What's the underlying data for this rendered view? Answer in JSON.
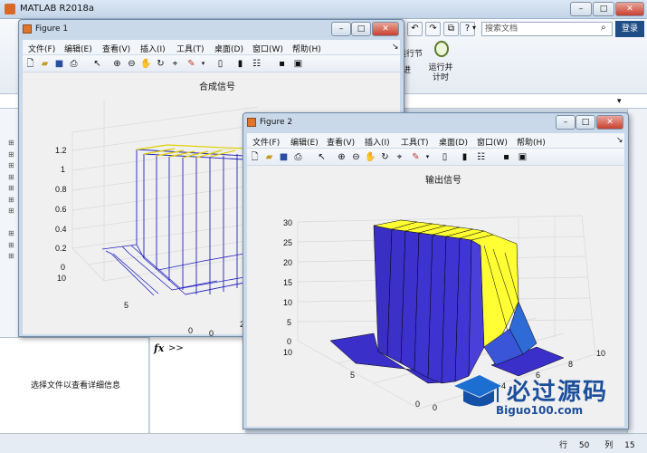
{
  "main_window": {
    "title": "MATLAB R2018a",
    "search_placeholder": "搜索文档",
    "login_label": "登录",
    "run_section_label": "运行节",
    "run_advance_label": "运行并\n计时",
    "advance_label": "进",
    "detail_panel_text": "选择文件以查看详细信息",
    "cmd_prompt": ">>",
    "fx_label": "fx",
    "status": {
      "row_label": "行",
      "row_value": "50",
      "col_label": "列",
      "col_value": "15"
    }
  },
  "figures": [
    {
      "title": "Figure 1",
      "menu": [
        "文件(F)",
        "编辑(E)",
        "查看(V)",
        "插入(I)",
        "工具(T)",
        "桌面(D)",
        "窗口(W)",
        "帮助(H)"
      ],
      "plot_title": "合成信号",
      "z_ticks": [
        "1.2",
        "1",
        "0.8",
        "0.6",
        "0.4",
        "0.2",
        "0"
      ],
      "y_ticks": [
        "10",
        "5",
        "0"
      ],
      "x_ticks": [
        "0",
        "2"
      ]
    },
    {
      "title": "Figure 2",
      "menu": [
        "文件(F)",
        "编辑(E)",
        "查看(V)",
        "插入(I)",
        "工具(T)",
        "桌面(D)",
        "窗口(W)",
        "帮助(H)"
      ],
      "plot_title": "输出信号",
      "z_ticks": [
        "30",
        "25",
        "20",
        "15",
        "10",
        "5",
        "0"
      ],
      "y_ticks": [
        "10",
        "5",
        "0"
      ],
      "x_ticks": [
        "0",
        "2",
        "4",
        "6",
        "8",
        "10"
      ]
    }
  ],
  "watermark": {
    "brand": "必过源码",
    "site": "Biguo100.com"
  },
  "colors": {
    "surface_yellow": "#ffff33",
    "surface_blue": "#3b2fc9",
    "surface_side": "#2e6bd6",
    "mesh_blue": "#2020c0"
  }
}
